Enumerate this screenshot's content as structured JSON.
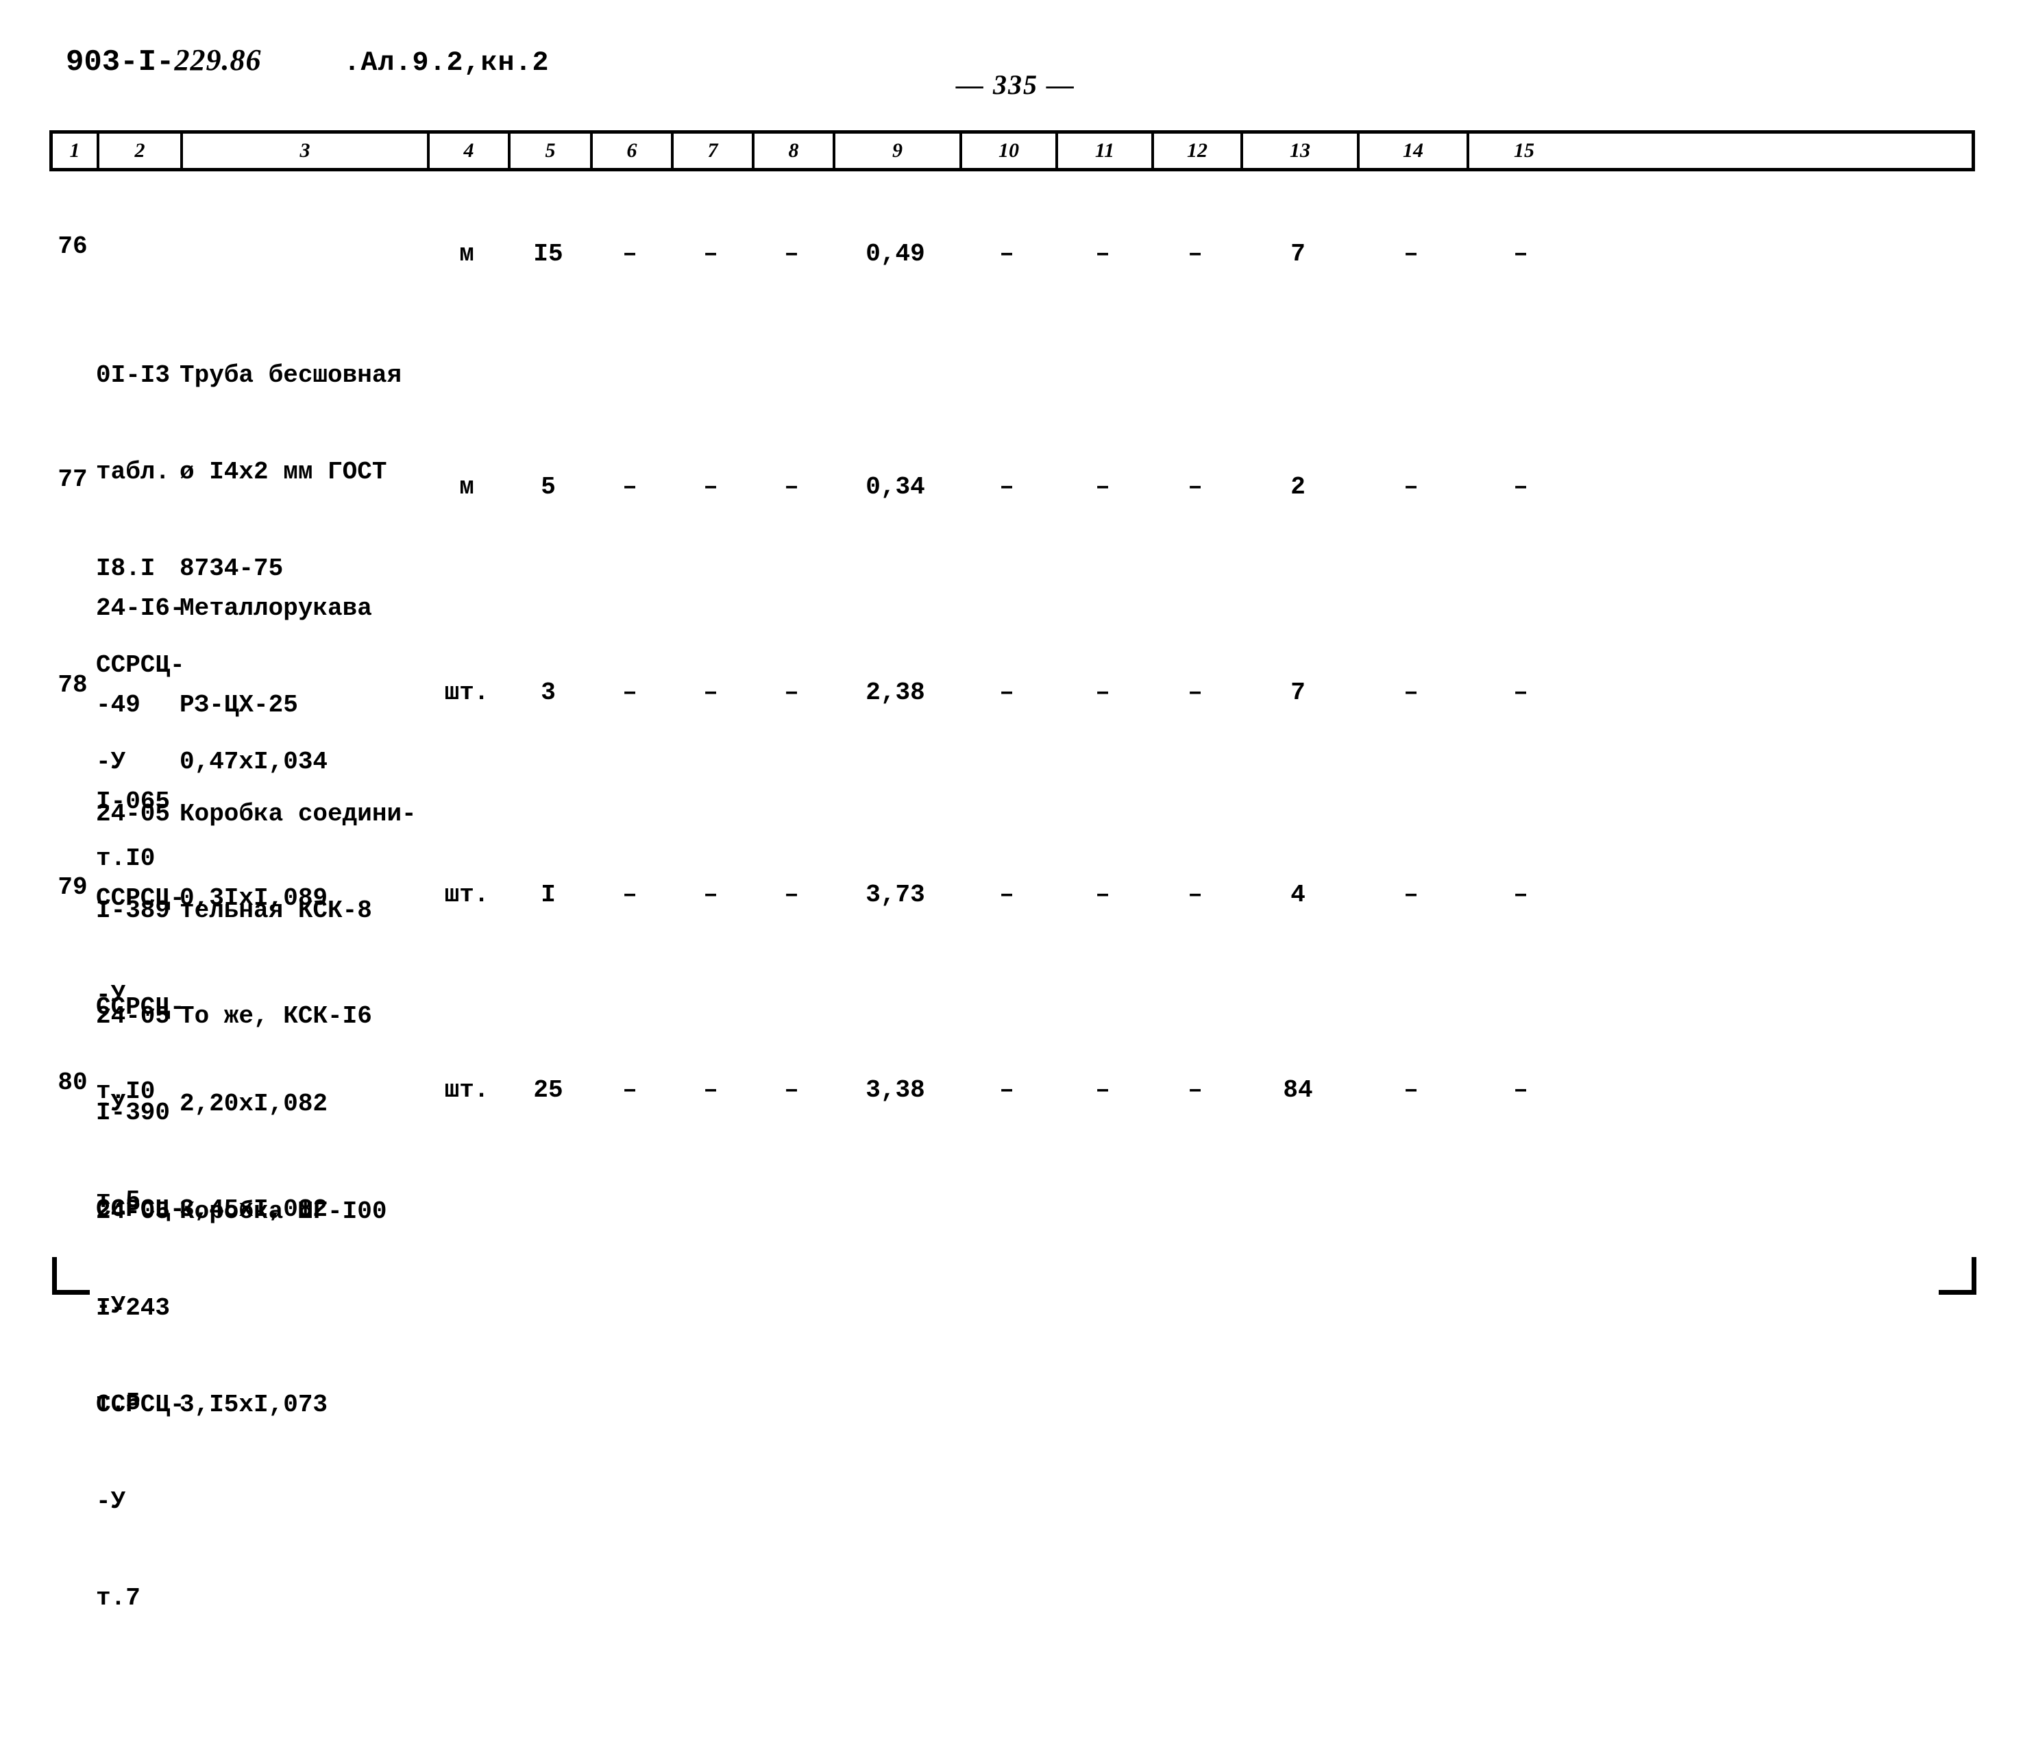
{
  "header": {
    "doc_code_prefix": "903-I-",
    "doc_code_suffix": "229.86",
    "album": ".Ал.9.2,кн.2",
    "page_number": "— 335 —"
  },
  "table": {
    "column_headers": [
      "1",
      "2",
      "3",
      "4",
      "5",
      "6",
      "7",
      "8",
      "9",
      "10",
      "11",
      "12",
      "13",
      "14",
      "15"
    ],
    "rows": [
      {
        "num": "76",
        "code_lines": [
          "0I-I3",
          "табл.",
          "I8.I",
          "ССРСЦ-",
          "-У",
          "т.I0"
        ],
        "desc_lines": [
          "Труба бесшовная",
          "ø I4x2 мм ГОСТ",
          "8734-75"
        ],
        "desc_coef": "0,47xI,034",
        "unit": "м",
        "qty": "I5",
        "c6": "–",
        "c7": "–",
        "c8": "–",
        "c9": "0,49",
        "c10": "–",
        "c11": "–",
        "c12": "–",
        "c13": "7",
        "c14": "–",
        "c15": "–"
      },
      {
        "num": "77",
        "code_lines": [
          "24-I6-",
          "-49",
          "I-065",
          "ССРСЦ-",
          "-У",
          "т.I0"
        ],
        "desc_lines": [
          "Металлорукава",
          "РЗ-ЦХ-25"
        ],
        "desc_coef": "0,3IxI,089",
        "unit": "м",
        "qty": "5",
        "c6": "–",
        "c7": "–",
        "c8": "–",
        "c9": "0,34",
        "c10": "–",
        "c11": "–",
        "c12": "–",
        "c13": "2",
        "c14": "–",
        "c15": "–"
      },
      {
        "num": "78",
        "code_lines": [
          "24-05",
          "I-389",
          "ССРСЦ-",
          "-У",
          "т.5"
        ],
        "desc_lines": [
          "Коробка соедини-",
          "тельная КСК-8"
        ],
        "desc_coef": "2,20xI,082",
        "unit": "шт.",
        "qty": "3",
        "c6": "–",
        "c7": "–",
        "c8": "–",
        "c9": "2,38",
        "c10": "–",
        "c11": "–",
        "c12": "–",
        "c13": "7",
        "c14": "–",
        "c15": "–"
      },
      {
        "num": "79",
        "code_lines": [
          "24-05",
          "I-390",
          "ССРСЦ-",
          "-У",
          "т.5"
        ],
        "desc_lines": [
          "То же, КСК-I6"
        ],
        "desc_coef": "3,45xI,082",
        "unit": "шт.",
        "qty": "I",
        "c6": "–",
        "c7": "–",
        "c8": "–",
        "c9": "3,73",
        "c10": "–",
        "c11": "–",
        "c12": "–",
        "c13": "4",
        "c14": "–",
        "c15": "–"
      },
      {
        "num": "80",
        "code_lines": [
          "24-05",
          "I-243",
          "ССРСЦ-",
          "-У",
          "т.7"
        ],
        "desc_lines": [
          "Коробка ШГ-I00"
        ],
        "desc_coef": "3,I5xI,073",
        "unit": "шт.",
        "qty": "25",
        "c6": "–",
        "c7": "–",
        "c8": "–",
        "c9": "3,38",
        "c10": "–",
        "c11": "–",
        "c12": "–",
        "c13": "84",
        "c14": "–",
        "c15": "–"
      }
    ]
  }
}
